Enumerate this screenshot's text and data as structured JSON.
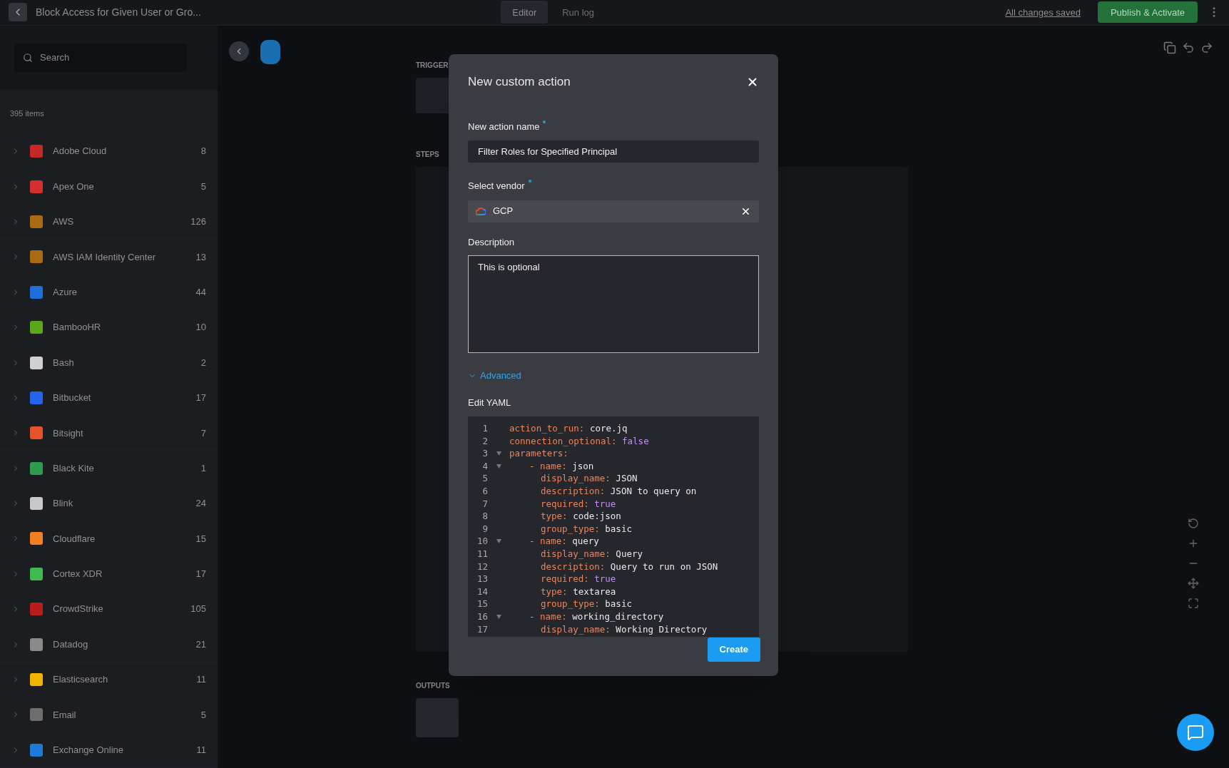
{
  "header": {
    "title": "Block Access for Given User or Gro...",
    "tabs": [
      {
        "label": "Editor",
        "selected": true
      },
      {
        "label": "Run log",
        "selected": false
      }
    ],
    "save_status": "All changes saved",
    "publish_button": "Publish & Activate"
  },
  "sidebar": {
    "search": {
      "placeholder": "Search"
    },
    "count": "395 items",
    "items": [
      {
        "name": "Adobe Cloud",
        "count": "8",
        "color": "#c62828"
      },
      {
        "name": "Apex One",
        "count": "5",
        "color": "#d32f2f"
      },
      {
        "name": "AWS",
        "count": "126",
        "color": "#a86a12"
      },
      {
        "name": "AWS IAM Identity Center",
        "count": "13",
        "color": "#a86a12"
      },
      {
        "name": "Azure",
        "count": "44",
        "color": "#1e6fd9"
      },
      {
        "name": "BambooHR",
        "count": "10",
        "color": "#5da51a"
      },
      {
        "name": "Bash",
        "count": "2",
        "color": "#d0d0d0"
      },
      {
        "name": "Bitbucket",
        "count": "17",
        "color": "#2563eb"
      },
      {
        "name": "Bitsight",
        "count": "7",
        "color": "#e5532d"
      },
      {
        "name": "Black Kite",
        "count": "1",
        "color": "#2e9b4f"
      },
      {
        "name": "Blink",
        "count": "24",
        "color": "#c8c8c8"
      },
      {
        "name": "Cloudflare",
        "count": "15",
        "color": "#f38020"
      },
      {
        "name": "Cortex XDR",
        "count": "17",
        "color": "#3fb950"
      },
      {
        "name": "CrowdStrike",
        "count": "105",
        "color": "#b91c1c"
      },
      {
        "name": "Datadog",
        "count": "21",
        "color": "#8a8a8a"
      },
      {
        "name": "Elasticsearch",
        "count": "11",
        "color": "#f0b400"
      },
      {
        "name": "Email",
        "count": "5",
        "color": "#6e6e6e"
      },
      {
        "name": "Exchange Online",
        "count": "11",
        "color": "#1f7ad6"
      }
    ]
  },
  "canvas": {
    "sections": [
      "TRIGGER",
      "STEPS",
      "OUTPUTS"
    ]
  },
  "dialog": {
    "title": "New custom action",
    "name_field": {
      "label": "New action name",
      "required": true,
      "value": "Filter Roles for Specified Principal"
    },
    "vendor_field": {
      "label": "Select vendor",
      "required": true,
      "value": "GCP"
    },
    "description_field": {
      "label": "Description",
      "placeholder": "This is optional"
    },
    "advanced": {
      "label": "Advanced",
      "expanded": true
    },
    "yaml": {
      "label": "Edit YAML",
      "lines": [
        {
          "n": "1",
          "key": "action_to_run:",
          "value": "core.jq",
          "kind": "plain"
        },
        {
          "n": "2",
          "key": "connection_optional:",
          "value": "false",
          "kind": "bool"
        },
        {
          "n": "3",
          "key": "parameters:",
          "children": [
            {
              "n": "4",
              "dash": "-",
              "key": "name:",
              "value": "json",
              "kind": "plain",
              "children": [
                {
                  "n": "5",
                  "key": "display_name:",
                  "value": "JSON",
                  "kind": "plain"
                },
                {
                  "n": "6",
                  "key": "description:",
                  "value": "JSON to query on",
                  "kind": "plain"
                },
                {
                  "n": "7",
                  "key": "required:",
                  "value": "true",
                  "kind": "bool"
                },
                {
                  "n": "8",
                  "key": "type:",
                  "value": "code:json",
                  "kind": "plain"
                },
                {
                  "n": "9",
                  "key": "group_type:",
                  "value": "basic",
                  "kind": "plain"
                }
              ]
            },
            {
              "n": "10",
              "dash": "-",
              "key": "name:",
              "value": "query",
              "kind": "plain",
              "children": [
                {
                  "n": "11",
                  "key": "display_name:",
                  "value": "Query",
                  "kind": "plain"
                },
                {
                  "n": "12",
                  "key": "description:",
                  "value": "Query to run on JSON",
                  "kind": "plain"
                },
                {
                  "n": "13",
                  "key": "required:",
                  "value": "true",
                  "kind": "bool"
                },
                {
                  "n": "14",
                  "key": "type:",
                  "value": "textarea",
                  "kind": "plain"
                },
                {
                  "n": "15",
                  "key": "group_type:",
                  "value": "basic",
                  "kind": "plain"
                }
              ]
            },
            {
              "n": "16",
              "dash": "-",
              "key": "name:",
              "value": "working_directory",
              "kind": "plain",
              "children": [
                {
                  "n": "17",
                  "key": "display_name:",
                  "value": "Working Directory",
                  "kind": "plain"
                }
              ]
            }
          ]
        }
      ]
    },
    "create_button": "Create"
  }
}
